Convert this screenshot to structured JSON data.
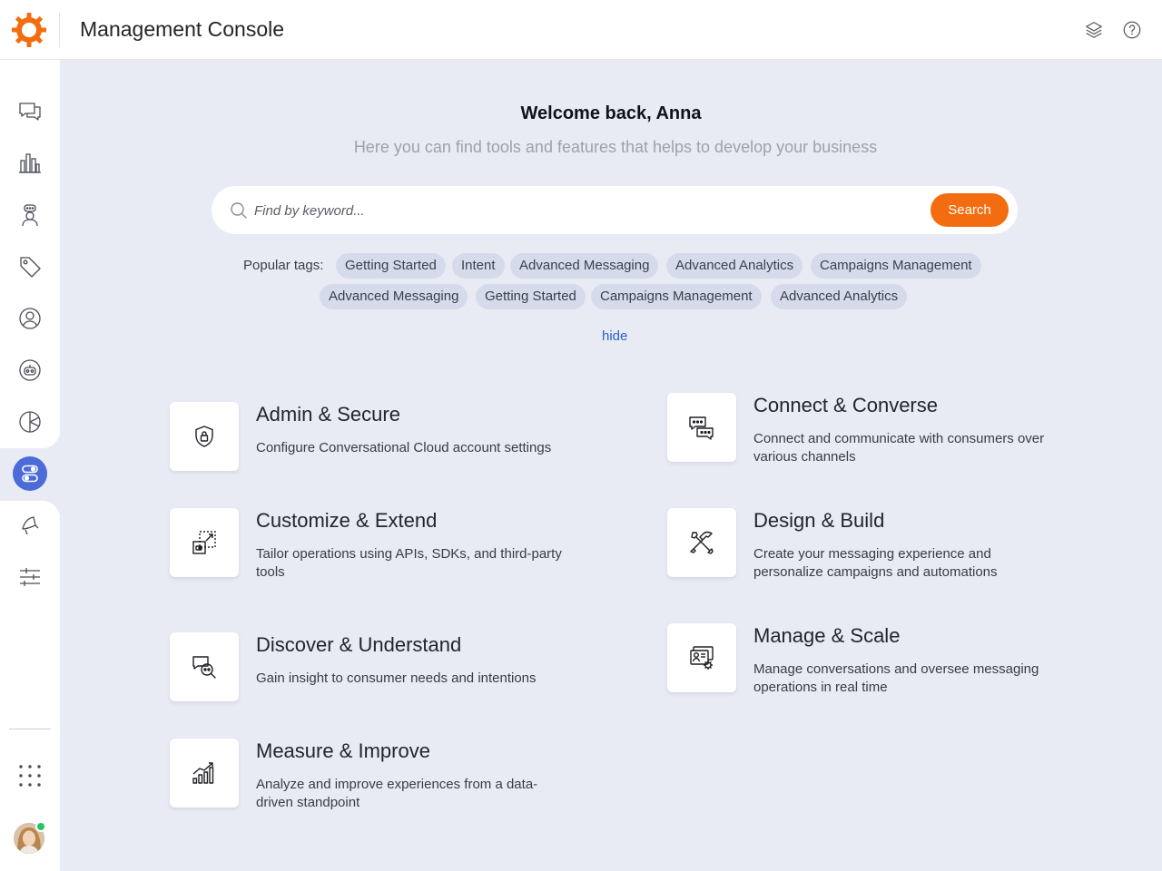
{
  "header": {
    "title": "Management Console"
  },
  "welcome": {
    "heading": "Welcome back, Anna",
    "subtitle": "Here you can find tools and features that helps to develop your business"
  },
  "search": {
    "placeholder": "Find by keyword...",
    "button_label": "Search"
  },
  "tags": {
    "label": "Popular tags:",
    "items": [
      "Getting Started",
      "Intent",
      "Advanced Messaging",
      "Advanced Analytics",
      "Campaigns Management",
      "Advanced Messaging",
      "Getting Started",
      "Campaigns Management",
      "Advanced Analytics"
    ],
    "toggle_label": "hide"
  },
  "categories": [
    {
      "title": "Admin & Secure",
      "description": "Configure Conversational Cloud account settings",
      "icon": "shield-lock-icon"
    },
    {
      "title": "Connect & Converse",
      "description": "Connect and communicate with consumers over various channels",
      "icon": "chat-bubbles-icon"
    },
    {
      "title": "Customize & Extend",
      "description": "Tailor operations using APIs, SDKs, and third-party tools",
      "icon": "extend-icon"
    },
    {
      "title": "Design & Build",
      "description": "Create your messaging experience and personalize campaigns and automations",
      "icon": "tools-icon"
    },
    {
      "title": "Discover & Understand",
      "description": "Gain insight to consumer needs and intentions",
      "icon": "insight-icon"
    },
    {
      "title": "Manage & Scale",
      "description": "Manage conversations and oversee messaging operations in real time",
      "icon": "manage-icon"
    },
    {
      "title": "Measure & Improve",
      "description": "Analyze and improve experiences from a data-driven standpoint",
      "icon": "growth-chart-icon"
    }
  ],
  "sidebar": {
    "icons": [
      "conversations-icon",
      "analytics-icon",
      "agent-icon",
      "tag-icon",
      "user-icon",
      "bot-icon",
      "reports-icon",
      "toggles-icon",
      "campaign-icon",
      "settings-sliders-icon",
      "apps-grid-icon"
    ],
    "active": "toggles-icon"
  },
  "colors": {
    "accent": "#f36d10",
    "active_nav": "#4b6bd8",
    "link": "#2861c9",
    "background": "#e8ebf4",
    "tag_bg": "#d6dbec",
    "status_online": "#22c55e"
  }
}
